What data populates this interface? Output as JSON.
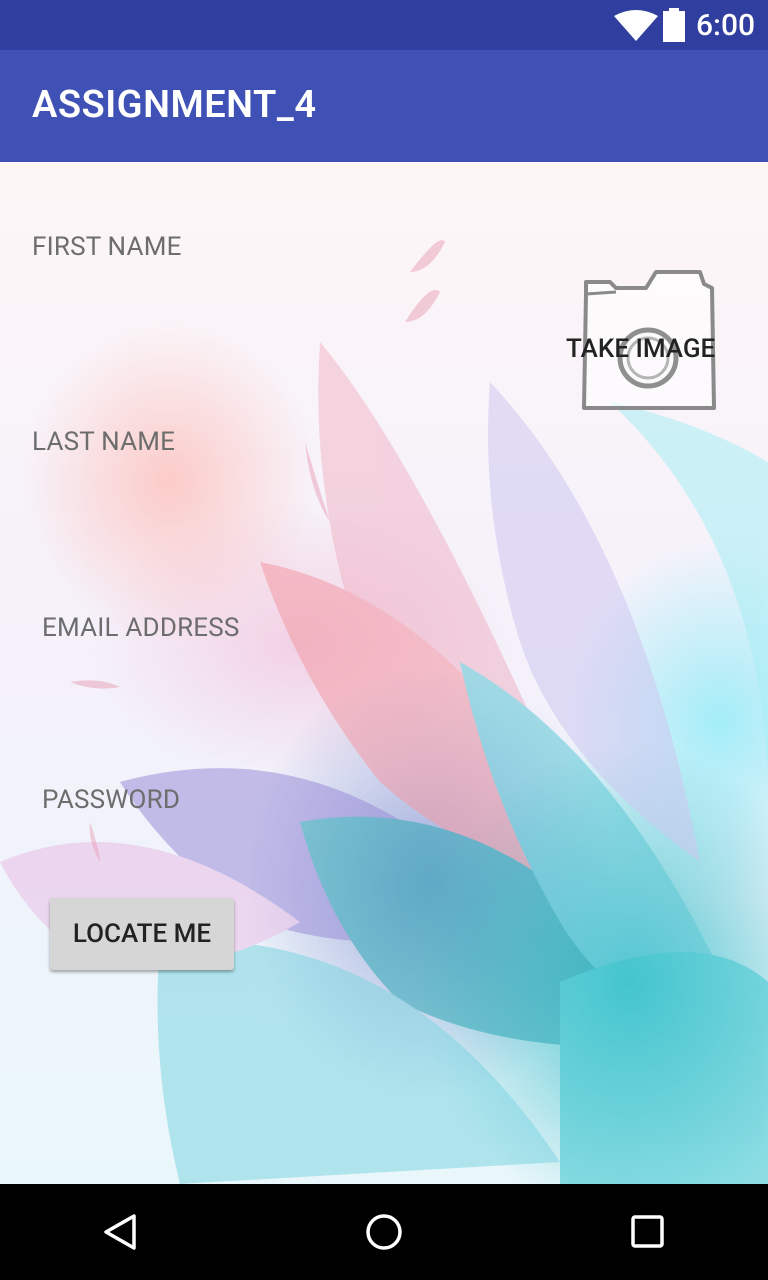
{
  "status_bar": {
    "time": "6:00",
    "wifi_icon": "wifi-icon",
    "battery_icon": "battery-icon"
  },
  "app_bar": {
    "title": "ASSIGNMENT_4"
  },
  "form": {
    "first_name_label": "FIRST NAME",
    "last_name_label": "LAST NAME",
    "email_label": "EMAIL ADDRESS",
    "password_label": "PASSWORD"
  },
  "camera": {
    "icon": "camera-icon",
    "label": "TAKE IMAGE"
  },
  "locate_button": {
    "label": "LOCATE ME"
  },
  "nav_bar": {
    "back_icon": "back-icon",
    "home_icon": "home-icon",
    "recents_icon": "recents-icon"
  },
  "colors": {
    "status_bar": "#303f9f",
    "app_bar": "#3f51b5",
    "nav_bar": "#000000"
  }
}
